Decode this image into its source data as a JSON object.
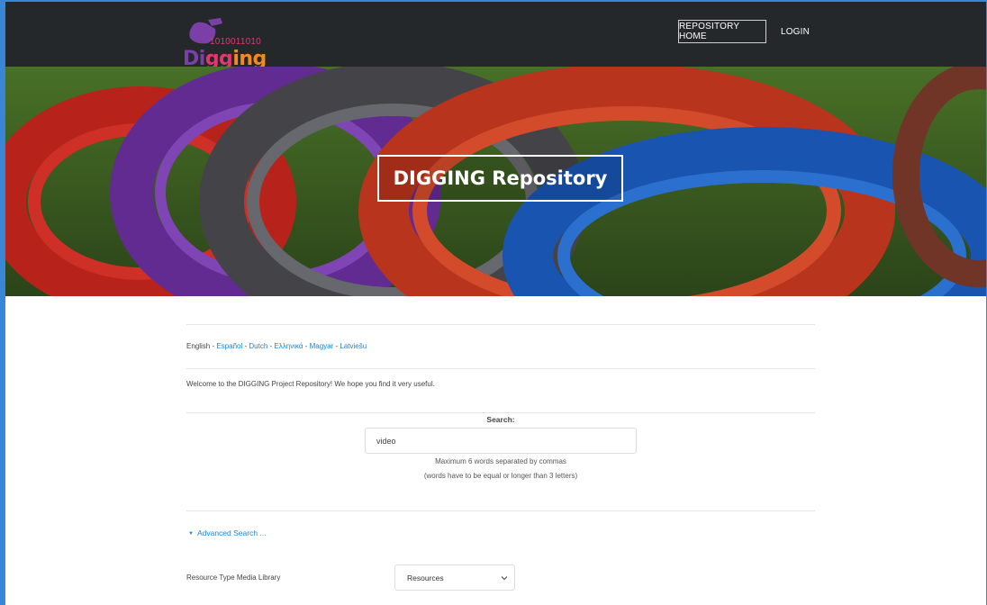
{
  "header": {
    "logo": {
      "binary": "1010011010",
      "word": "Digging"
    },
    "nav": {
      "home_label": "REPOSITORY HOME",
      "login_label": "LOGIN"
    }
  },
  "hero": {
    "title": "DIGGING Repository"
  },
  "languages": {
    "current": "English",
    "links": [
      "Español",
      "Dutch",
      "Ελληνικά",
      "Magyar",
      "Latviešu"
    ],
    "separator": " - "
  },
  "welcome_text": "Welcome to the DIGGING Project Repository! We hope you find it very useful.",
  "search": {
    "label": "Search:",
    "value": "video",
    "hint1": "Maximum 6 words separated by commas",
    "hint2": "(words have to be equal or longer than 3 letters)"
  },
  "advanced_search": {
    "label": "Advanced Search ..."
  },
  "resource_type": {
    "label": "Resource Type Media Library",
    "selected": "Resources"
  },
  "colors": {
    "accent": "#1a84d8",
    "header_bg": "#25282b",
    "frame": "#3a86d6",
    "logo_purple": "#7b3fa8",
    "logo_pink": "#e0386e",
    "logo_orange": "#f28b1e"
  }
}
